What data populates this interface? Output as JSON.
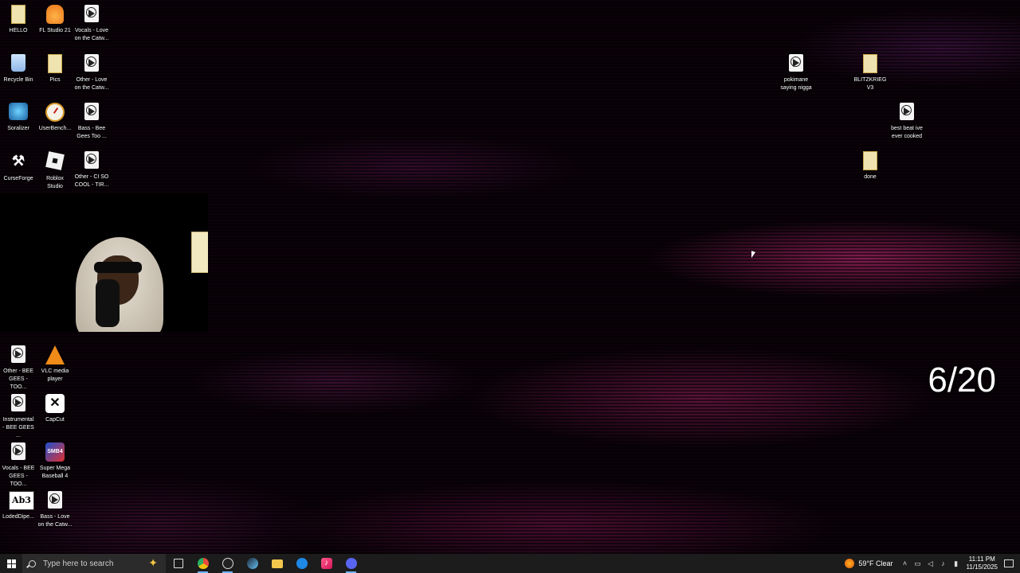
{
  "desktop_icons": [
    {
      "label": "HELLO"
    },
    {
      "label": "FL Studio 21"
    },
    {
      "label": "Vocals - Love\non the Catw..."
    },
    {
      "label": "Recycle Bin"
    },
    {
      "label": "Pics"
    },
    {
      "label": "Other - Love\non the Catw..."
    },
    {
      "label": "Soralizer"
    },
    {
      "label": "UserBench..."
    },
    {
      "label": "Bass - Bee\nGees   Too ..."
    },
    {
      "label": "CurseForge"
    },
    {
      "label": "Roblox\nStudio"
    },
    {
      "label": "Other - CI SO\nCOOL - TIR..."
    },
    {
      "label": "Other - BEE\nGEES - TOO..."
    },
    {
      "label": "VLC media\nplayer"
    },
    {
      "label": "Instrumental\n- BEE GEES ..."
    },
    {
      "label": "CapCut"
    },
    {
      "label": "Vocals - BEE\nGEES - TOO..."
    },
    {
      "label": "Super Mega\nBaseball 4"
    },
    {
      "label": "LodedDipe..."
    },
    {
      "label": "Bass - Love\non the Catw..."
    },
    {
      "label": "pokimane\nsaying nigga"
    },
    {
      "label": "BLITZKRIEG\nV3"
    },
    {
      "label": "best beat ive\never cooked"
    },
    {
      "label": "done"
    }
  ],
  "overlay_counter": "6/20",
  "taskbar": {
    "search_placeholder": "Type here to search",
    "weather": "59°F  Clear",
    "time": "11:11 PM",
    "date": "11/15/2025"
  },
  "colors": {
    "taskbar_bg": "#1c1c1c",
    "accent": "#6fb3ff",
    "wallpaper_glow": "#e0328c"
  }
}
